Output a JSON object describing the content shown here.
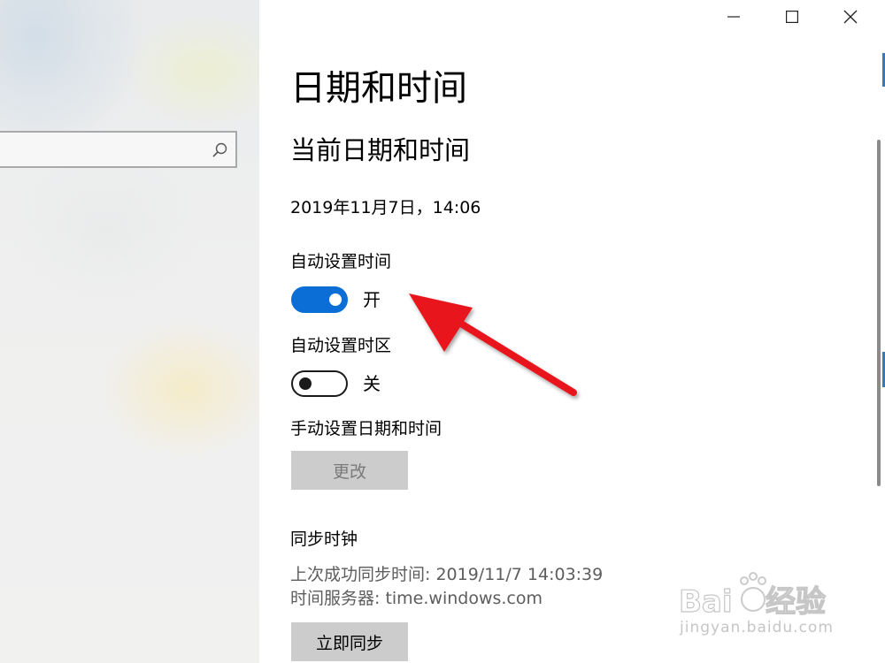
{
  "window": {
    "minimize_icon": "minimize-icon",
    "maximize_icon": "maximize-icon",
    "close_icon": "close-icon"
  },
  "nav": {
    "search": {
      "value": "",
      "icon": "search-icon"
    }
  },
  "page": {
    "title": "日期和时间",
    "current_section": "当前日期和时间",
    "current_datetime": "2019年11月7日，14:06",
    "auto_time": {
      "label": "自动设置时间",
      "state": "开",
      "on": true
    },
    "auto_zone": {
      "label": "自动设置时区",
      "state": "关",
      "on": false
    },
    "manual": {
      "label": "手动设置日期和时间",
      "button": "更改"
    },
    "sync": {
      "title": "同步时钟",
      "last_sync": "上次成功同步时间: 2019/11/7 14:03:39",
      "server": "时间服务器: time.windows.com",
      "button": "立即同步"
    }
  },
  "colors": {
    "accent": "#0b6ed6",
    "annotation_arrow": "#e8141c",
    "button_bg": "#cccccc"
  },
  "watermark": {
    "logo": "Baidu经验",
    "url": "jingyan.baidu.com"
  }
}
